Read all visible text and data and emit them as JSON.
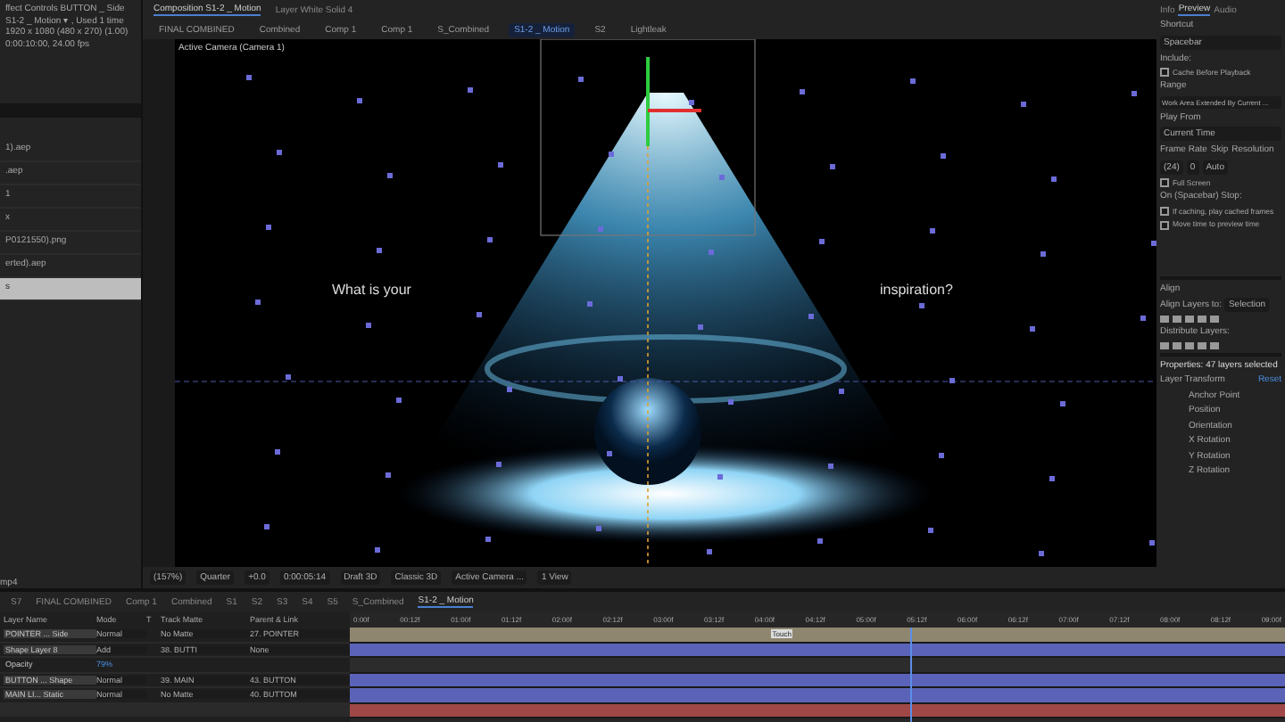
{
  "project": {
    "title": "ffect Controls BUTTON _ Side",
    "info": [
      "S1-2 _ Motion ▾ , Used 1 time",
      "1920 x 1080  (480 x 270) (1.00)",
      "0:00:10:00, 24.00 fps"
    ],
    "items": [
      {
        "label": "1).aep",
        "selected": false
      },
      {
        "label": ".aep",
        "selected": false
      },
      {
        "label": "1",
        "selected": false
      },
      {
        "label": "x",
        "selected": false
      },
      {
        "label": "P0121550).png",
        "selected": false
      },
      {
        "label": "erted).aep",
        "selected": false
      },
      {
        "label": "s",
        "selected": true
      }
    ],
    "footer": "mp4"
  },
  "viewer": {
    "tabs": [
      {
        "label": "Composition S1-2 _ Motion",
        "selected": true
      },
      {
        "label": "Layer White Solid 4",
        "selected": false
      }
    ],
    "breadcrumbs": [
      {
        "label": "FINAL COMBINED",
        "selected": false
      },
      {
        "label": "Combined",
        "selected": false
      },
      {
        "label": "Comp 1",
        "selected": false
      },
      {
        "label": "Comp 1",
        "selected": false
      },
      {
        "label": "S_Combined",
        "selected": false
      },
      {
        "label": "S1-2 _ Motion",
        "selected": true
      },
      {
        "label": "S2",
        "selected": false
      },
      {
        "label": "Lightleak",
        "selected": false
      }
    ],
    "camera_label": "Active Camera (Camera 1)",
    "left_text": "What is your",
    "right_text": "inspiration?",
    "toolbar": {
      "zoom": "(157%)",
      "resolution": "Quarter",
      "exposure": "+0.0",
      "timecode": "0:00:05:14",
      "draft": "Draft 3D",
      "renderer": "Classic 3D",
      "view": "Active Camera ...",
      "layout": "1 View"
    }
  },
  "side": {
    "tabs": [
      {
        "label": "Info",
        "selected": false
      },
      {
        "label": "Preview",
        "selected": true
      },
      {
        "label": "Audio",
        "selected": false
      }
    ],
    "shortcut_label": "Shortcut",
    "shortcut": "Spacebar",
    "include_label": "Include:",
    "cache": {
      "label": "Cache Before Playback",
      "checked": false
    },
    "range_label": "Range",
    "range": "Work Area Extended By Current ...",
    "play_from_label": "Play From",
    "play_from": "Current Time",
    "fr_labels": [
      "Frame Rate",
      "Skip",
      "Resolution"
    ],
    "fr_values": [
      "(24)",
      "0",
      "Auto"
    ],
    "full_screen": {
      "label": "Full Screen",
      "checked": false
    },
    "stop_label": "On (Spacebar) Stop:",
    "stop_options": [
      {
        "label": "If caching, play cached frames",
        "checked": false
      },
      {
        "label": "Move time to preview time",
        "checked": false
      }
    ],
    "align_title": "Align",
    "align_to_label": "Align Layers to:",
    "align_to": "Selection",
    "distribute_label": "Distribute Layers:",
    "properties_title": "Properties: 47 layers selected",
    "transform_label": "Layer Transform",
    "reset": "Reset",
    "props": [
      "Anchor Point",
      "Position",
      "Orientation",
      "X Rotation",
      "Y Rotation",
      "Z Rotation"
    ]
  },
  "timeline": {
    "tabs": [
      {
        "label": "S7",
        "selected": false
      },
      {
        "label": "FINAL COMBINED",
        "selected": false
      },
      {
        "label": "Comp 1",
        "selected": false
      },
      {
        "label": "Combined",
        "selected": false
      },
      {
        "label": "S1",
        "selected": false
      },
      {
        "label": "S2",
        "selected": false
      },
      {
        "label": "S3",
        "selected": false
      },
      {
        "label": "S4",
        "selected": false
      },
      {
        "label": "S5",
        "selected": false
      },
      {
        "label": "S_Combined",
        "selected": false
      },
      {
        "label": "S1-2 _ Motion",
        "selected": true
      }
    ],
    "columns": [
      "Layer Name",
      "Mode",
      "T",
      "Track Matte",
      "Parent & Link"
    ],
    "ruler": [
      "0:00f",
      "00:12f",
      "01:00f",
      "01:12f",
      "02:00f",
      "02:12f",
      "03:00f",
      "03:12f",
      "04:00f",
      "04:12f",
      "05:00f",
      "05:12f",
      "06:00f",
      "06:12f",
      "07:00f",
      "07:12f",
      "08:00f",
      "08:12f",
      "09:00f"
    ],
    "marker": "Touch",
    "playhead": {
      "level": 0.6
    },
    "rows": [
      {
        "kind": "layer",
        "name": "POINTER ... Side",
        "mode": "Normal",
        "matte": "No Matte",
        "parent": "27. POINTER",
        "color": "#8f8670"
      },
      {
        "kind": "layer",
        "name": "Shape Layer 8",
        "mode": "Add",
        "matte": "38. BUTTI",
        "parent": "None",
        "color": "#5b63b8"
      },
      {
        "kind": "property",
        "name": "Opacity",
        "value": "79%"
      },
      {
        "kind": "layer",
        "name": "BUTTON ... Shape",
        "mode": "Normal",
        "matte": "39. MAIN",
        "parent": "43. BUTTON",
        "color": "#5b63b8"
      },
      {
        "kind": "layer",
        "name": "MAIN LI... Static",
        "mode": "Normal",
        "matte": "No Matte",
        "parent": "40. BUTTOM",
        "color": "#5b63b8"
      },
      {
        "kind": "empty",
        "color": "#a04848"
      }
    ]
  }
}
